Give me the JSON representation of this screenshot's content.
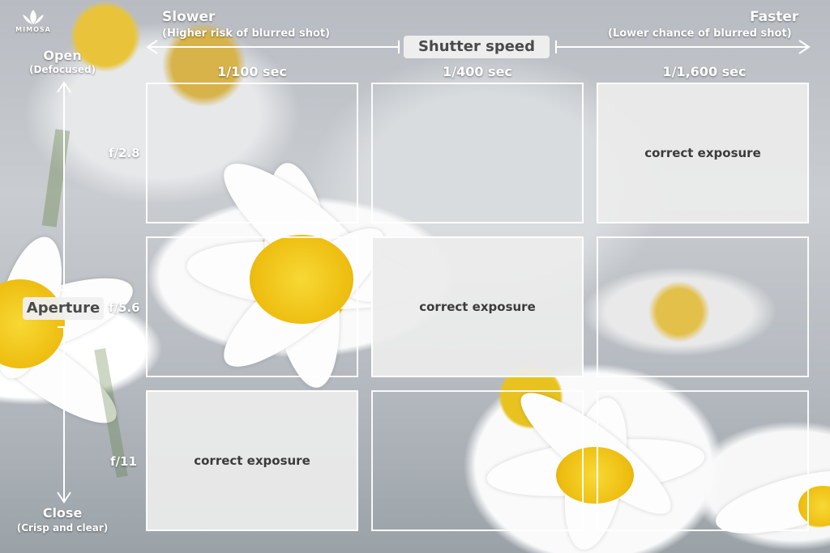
{
  "logo": {
    "text": "MIMOSA"
  },
  "shutter": {
    "title": "Shutter speed",
    "slow_label": "Slower",
    "slow_note": "(Higher risk of blurred shot)",
    "fast_label": "Faster",
    "fast_note": "(Lower chance of blurred shot)",
    "speeds": [
      "1/100 sec",
      "1/400 sec",
      "1/1,600 sec"
    ]
  },
  "aperture": {
    "title": "Aperture",
    "open_label": "Open",
    "open_note": "(Defocused)",
    "close_label": "Close",
    "close_note": "(Crisp and clear)",
    "stops": [
      "f/2.8",
      "f/5.6",
      "f/11"
    ]
  },
  "grid": {
    "rows": [
      [
        {
          "label": ""
        },
        {
          "label": ""
        },
        {
          "label": "correct exposure"
        }
      ],
      [
        {
          "label": ""
        },
        {
          "label": "correct exposure"
        },
        {
          "label": ""
        }
      ],
      [
        {
          "label": "correct exposure"
        },
        {
          "label": ""
        },
        {
          "label": ""
        }
      ]
    ]
  },
  "colors": {
    "overlay_text": "#ffffff",
    "cell_fill": "#ececec",
    "cell_text": "#3b3b3b",
    "flower_center": "#f2cc1a"
  }
}
